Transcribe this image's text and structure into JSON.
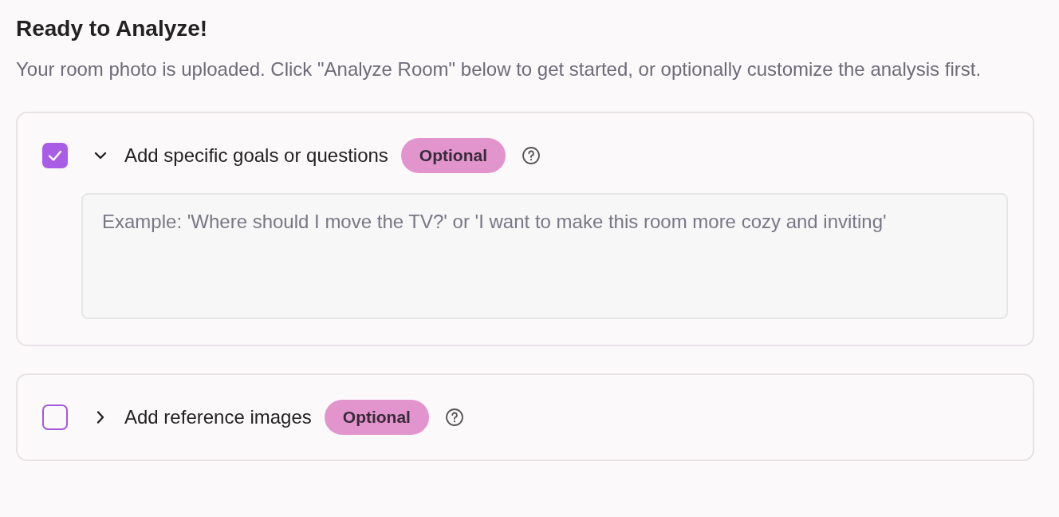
{
  "heading": "Ready to Analyze!",
  "intro": "Your room photo is uploaded. Click \"Analyze Room\" below to get started, or optionally customize the analysis first.",
  "sections": [
    {
      "label": "Add specific goals or questions",
      "badge": "Optional",
      "checked": true,
      "expanded": true,
      "field": {
        "placeholder": "Example: 'Where should I move the TV?' or 'I want to make this room more cozy and inviting'"
      }
    },
    {
      "label": "Add reference images",
      "badge": "Optional",
      "checked": false,
      "expanded": false
    }
  ]
}
